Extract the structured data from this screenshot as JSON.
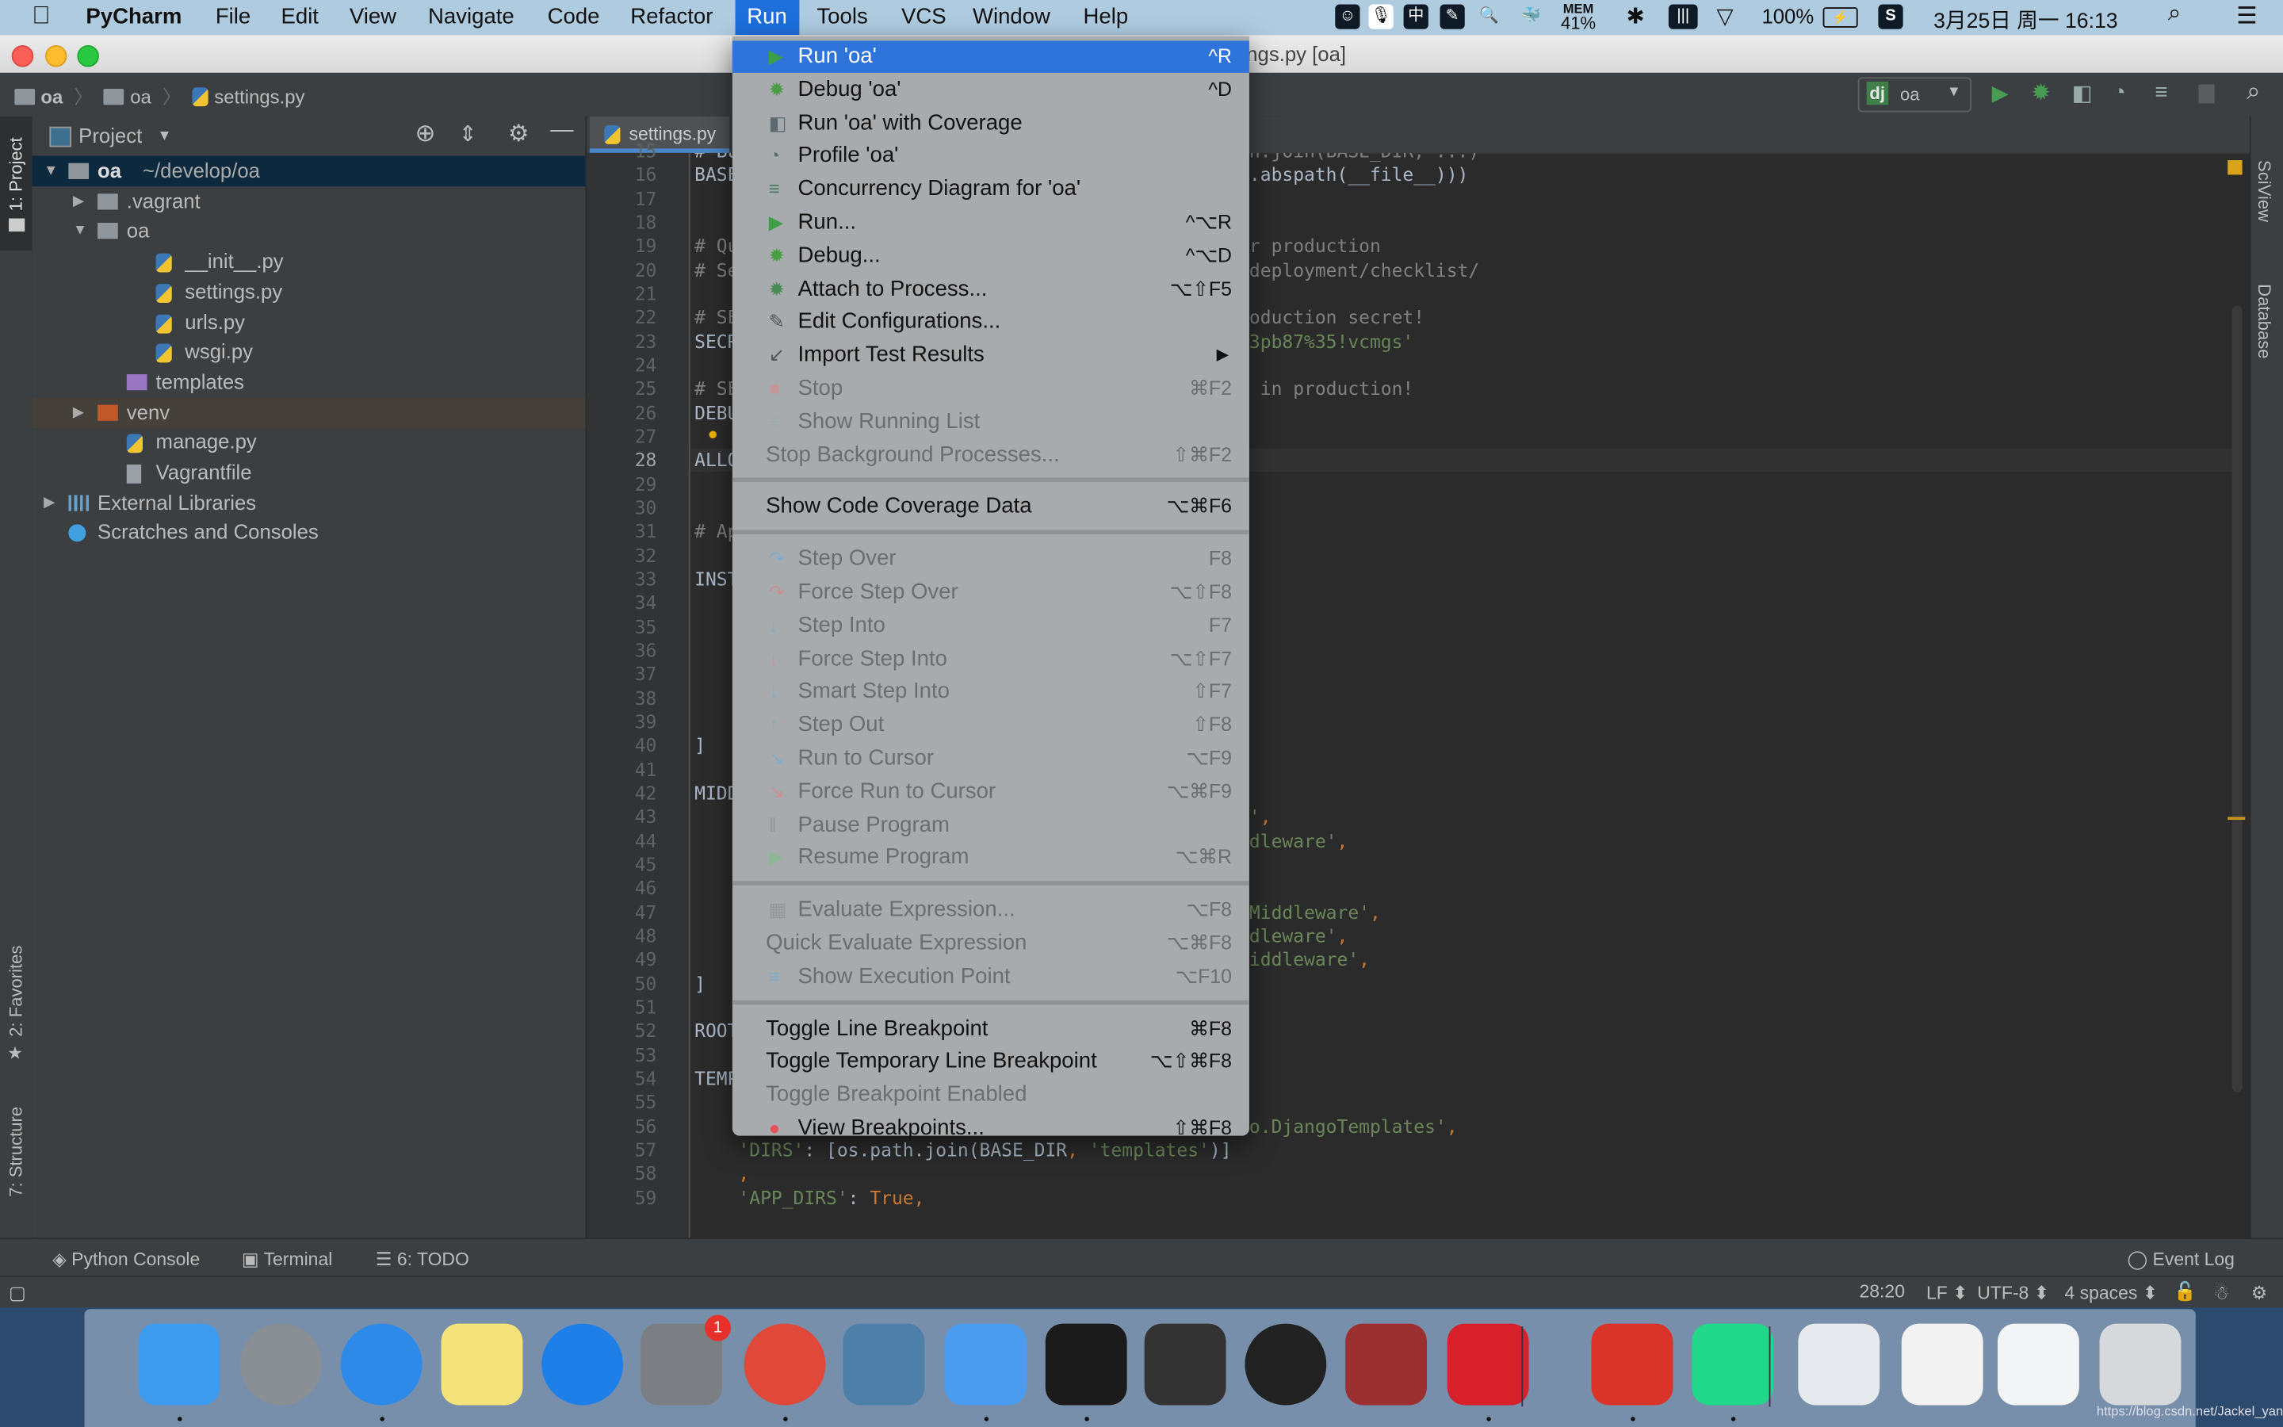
{
  "menubar": {
    "app": "PyCharm",
    "items": [
      "File",
      "Edit",
      "View",
      "Navigate",
      "Code",
      "Refactor",
      "Run",
      "Tools",
      "VCS",
      "Window",
      "Help"
    ],
    "active": "Run",
    "status": {
      "mem_label": "MEM",
      "mem_value": "41%",
      "battery": "100%",
      "datetime": "3月25日 周一 16:13"
    },
    "status_icons": [
      "smiley-icon",
      "microphone-icon",
      "chinese-input-icon",
      "pen-icon",
      "search-doc-icon",
      "docker-icon",
      "bluetooth-icon",
      "battery-cells-icon",
      "wifi-icon",
      "battery-icon",
      "s-app-icon",
      "spotlight-icon",
      "notification-list-icon"
    ]
  },
  "window": {
    "title_visible": "ngs.py [oa]"
  },
  "breadcrumb": [
    "oa",
    "oa",
    "settings.py"
  ],
  "run_config": {
    "badge": "dj",
    "name": "oa"
  },
  "colors": {
    "accent": "#2f74da",
    "menubar": "#aecbe0",
    "editor_bg": "#2b2b2b",
    "panel_bg": "#3c3f41",
    "selection": "#0d293e",
    "run_green": "#499c54"
  },
  "left_strip": {
    "project": "1: Project",
    "favorites": "2: Favorites",
    "structure": "7: Structure"
  },
  "right_strip": {
    "sciview": "SciView",
    "database": "Database"
  },
  "project": {
    "title": "Project",
    "tree": [
      {
        "name": "oa",
        "extra": "~/develop/oa",
        "depth": 0,
        "arrow": "down",
        "icon": "folder",
        "bold": true,
        "selected": true
      },
      {
        "name": ".vagrant",
        "depth": 1,
        "arrow": "right",
        "icon": "folder"
      },
      {
        "name": "oa",
        "depth": 1,
        "arrow": "down",
        "icon": "package"
      },
      {
        "name": "__init__.py",
        "depth": 3,
        "icon": "python"
      },
      {
        "name": "settings.py",
        "depth": 3,
        "icon": "python"
      },
      {
        "name": "urls.py",
        "depth": 3,
        "icon": "python"
      },
      {
        "name": "wsgi.py",
        "depth": 3,
        "icon": "python"
      },
      {
        "name": "templates",
        "depth": 2,
        "icon": "template-folder"
      },
      {
        "name": "venv",
        "depth": 1,
        "arrow": "right",
        "icon": "venv-folder",
        "highlight": true
      },
      {
        "name": "manage.py",
        "depth": 2,
        "icon": "python"
      },
      {
        "name": "Vagrantfile",
        "depth": 2,
        "icon": "text"
      },
      {
        "name": "External Libraries",
        "depth": 0,
        "arrow": "right",
        "icon": "libraries"
      },
      {
        "name": "Scratches and Consoles",
        "depth": 0,
        "icon": "scratches"
      }
    ]
  },
  "editor": {
    "tab": "settings.py",
    "current_line": 28,
    "lines": [
      {
        "n": 15,
        "l": "# Bu",
        "r": "n.join(BASE_DIR, ...)",
        "rc": "comment"
      },
      {
        "n": 16,
        "l": "BASE",
        "r": ".abspath(__file__)))"
      },
      {
        "n": 17
      },
      {
        "n": 18
      },
      {
        "n": 19,
        "l": "# Qu",
        "r": "r production",
        "lc": "comment",
        "rc": "comment"
      },
      {
        "n": 20,
        "l": "# Se",
        "r": "deployment/checklist/",
        "lc": "comment",
        "rc": "comment"
      },
      {
        "n": 21
      },
      {
        "n": 22,
        "l": "# SE",
        "r": "oduction secret!",
        "lc": "comment",
        "rc": "comment"
      },
      {
        "n": 23,
        "l": "SECR",
        "r": "3pb87%35!vcmgs'",
        "rc": "string"
      },
      {
        "n": 24
      },
      {
        "n": 25,
        "l": "# SE",
        "r": " in production!",
        "lc": "comment",
        "rc": "comment"
      },
      {
        "n": 26,
        "l": "DEBU"
      },
      {
        "n": 27
      },
      {
        "n": 28,
        "l": "ALLO"
      },
      {
        "n": 29
      },
      {
        "n": 30
      },
      {
        "n": 31,
        "l": "# Ap",
        "lc": "comment"
      },
      {
        "n": 32
      },
      {
        "n": 33,
        "l": "INST"
      },
      {
        "n": 34
      },
      {
        "n": 35
      },
      {
        "n": 36
      },
      {
        "n": 37
      },
      {
        "n": 38
      },
      {
        "n": 39
      },
      {
        "n": 40,
        "l": "]"
      },
      {
        "n": 41
      },
      {
        "n": 42,
        "l": "MIDD"
      },
      {
        "n": 43,
        "r": "',",
        "rc": "string"
      },
      {
        "n": 44,
        "r": "dleware',",
        "rc": "string"
      },
      {
        "n": 45
      },
      {
        "n": 46
      },
      {
        "n": 47,
        "r": "Middleware',",
        "rc": "string"
      },
      {
        "n": 48,
        "r": "dleware',",
        "rc": "string"
      },
      {
        "n": 49,
        "r": "iddleware',",
        "rc": "string"
      },
      {
        "n": 50,
        "l": "]"
      },
      {
        "n": 51
      },
      {
        "n": 52,
        "l": "ROOT"
      },
      {
        "n": 53
      },
      {
        "n": 54,
        "l": "TEMP"
      },
      {
        "n": 55
      },
      {
        "n": 56,
        "r": "o.DjangoTemplates',",
        "rc": "string"
      },
      {
        "n": 57,
        "full": "    'DIRS': [os.path.join(BASE_DIR, 'templates')]"
      },
      {
        "n": 58,
        "full": "    ,"
      },
      {
        "n": 59,
        "full": "    'APP_DIRS': True,"
      }
    ]
  },
  "run_menu": [
    {
      "label": "Run 'oa'",
      "shortcut": "^R",
      "icon": "run",
      "highlight": true
    },
    {
      "label": "Debug 'oa'",
      "shortcut": "^D",
      "icon": "debug"
    },
    {
      "label": "Run 'oa' with Coverage",
      "icon": "coverage"
    },
    {
      "label": "Profile 'oa'",
      "icon": "profile"
    },
    {
      "label": "Concurrency Diagram for 'oa'",
      "icon": "concurrency"
    },
    {
      "label": "Run...",
      "shortcut": "^⌥R",
      "icon": "run"
    },
    {
      "label": "Debug...",
      "shortcut": "^⌥D",
      "icon": "debug"
    },
    {
      "label": "Attach to Process...",
      "shortcut": "⌥⇧F5",
      "icon": "attach"
    },
    {
      "label": "Edit Configurations...",
      "icon": "edit"
    },
    {
      "label": "Import Test Results",
      "icon": "import",
      "submenu": true
    },
    {
      "label": "Stop",
      "shortcut": "⌘F2",
      "icon": "stop",
      "disabled": true
    },
    {
      "label": "Show Running List",
      "icon": "running-list",
      "disabled": true
    },
    {
      "label": "Stop Background Processes...",
      "shortcut": "⇧⌘F2",
      "disabled": true
    },
    {
      "sep": true
    },
    {
      "label": "Show Code Coverage Data",
      "shortcut": "⌥⌘F6"
    },
    {
      "sep": true
    },
    {
      "label": "Step Over",
      "shortcut": "F8",
      "icon": "step-over",
      "disabled": true
    },
    {
      "label": "Force Step Over",
      "shortcut": "⌥⇧F8",
      "icon": "force-step-over",
      "disabled": true
    },
    {
      "label": "Step Into",
      "shortcut": "F7",
      "icon": "step-into",
      "disabled": true
    },
    {
      "label": "Force Step Into",
      "shortcut": "⌥⇧F7",
      "icon": "force-step-into",
      "disabled": true
    },
    {
      "label": "Smart Step Into",
      "shortcut": "⇧F7",
      "icon": "smart-step-into",
      "disabled": true
    },
    {
      "label": "Step Out",
      "shortcut": "⇧F8",
      "icon": "step-out",
      "disabled": true
    },
    {
      "label": "Run to Cursor",
      "shortcut": "⌥F9",
      "icon": "run-to-cursor",
      "disabled": true
    },
    {
      "label": "Force Run to Cursor",
      "shortcut": "⌥⌘F9",
      "icon": "force-run-to-cursor",
      "disabled": true
    },
    {
      "label": "Pause Program",
      "icon": "pause",
      "disabled": true
    },
    {
      "label": "Resume Program",
      "shortcut": "⌥⌘R",
      "icon": "resume",
      "disabled": true
    },
    {
      "sep": true
    },
    {
      "label": "Evaluate Expression...",
      "shortcut": "⌥F8",
      "icon": "calculator",
      "disabled": true
    },
    {
      "label": "Quick Evaluate Expression",
      "shortcut": "⌥⌘F8",
      "disabled": true
    },
    {
      "label": "Show Execution Point",
      "shortcut": "⌥F10",
      "icon": "execution-point",
      "disabled": true
    },
    {
      "sep": true
    },
    {
      "label": "Toggle Line Breakpoint",
      "shortcut": "⌘F8"
    },
    {
      "label": "Toggle Temporary Line Breakpoint",
      "shortcut": "⌥⇧⌘F8"
    },
    {
      "label": "Toggle Breakpoint Enabled",
      "disabled": true
    },
    {
      "label": "View Breakpoints...",
      "shortcut": "⇧⌘F8",
      "icon": "breakpoints"
    }
  ],
  "bottom_tools": {
    "python_console": "Python Console",
    "terminal": "Terminal",
    "todo": "6: TODO",
    "event_log": "Event Log"
  },
  "status": {
    "position": "28:20",
    "line_sep": "LF",
    "encoding": "UTF-8",
    "indent": "4 spaces"
  },
  "dock": [
    {
      "name": "finder",
      "color": "#3d9bf0",
      "running": true
    },
    {
      "name": "launchpad",
      "color": "#8a8f96"
    },
    {
      "name": "safari",
      "color": "#2d8ae8",
      "running": true
    },
    {
      "name": "notes",
      "color": "#f4e27a"
    },
    {
      "name": "app-store",
      "color": "#1f7fe8"
    },
    {
      "name": "system-preferences",
      "color": "#7b7f84",
      "badge": "1"
    },
    {
      "name": "chrome",
      "color": "#e0483a",
      "running": true
    },
    {
      "name": "list-app",
      "color": "#4d7fa8"
    },
    {
      "name": "pen-app",
      "color": "#4a9cf0",
      "running": true
    },
    {
      "name": "terminal",
      "color": "#1b1b1b",
      "running": true
    },
    {
      "name": "txt-editor",
      "color": "#333333"
    },
    {
      "name": "activity-monitor",
      "color": "#222222"
    },
    {
      "name": "dictionary",
      "color": "#9c2f2f"
    },
    {
      "name": "youdao",
      "color": "#d7202a",
      "running": true
    },
    {
      "name": "pdf-expert",
      "color": "#d9332a",
      "running": true
    },
    {
      "name": "pycharm",
      "color": "#21d789",
      "running": true
    },
    {
      "name": "document-folder",
      "color": "#e6eaee"
    },
    {
      "name": "youdao-window",
      "color": "#f2f2f2"
    },
    {
      "name": "window-preview",
      "color": "#f2f4f6"
    },
    {
      "name": "trash",
      "color": "#d6d9dc"
    }
  ],
  "watermark": "https://blog.csdn.net/Jackel_yan"
}
